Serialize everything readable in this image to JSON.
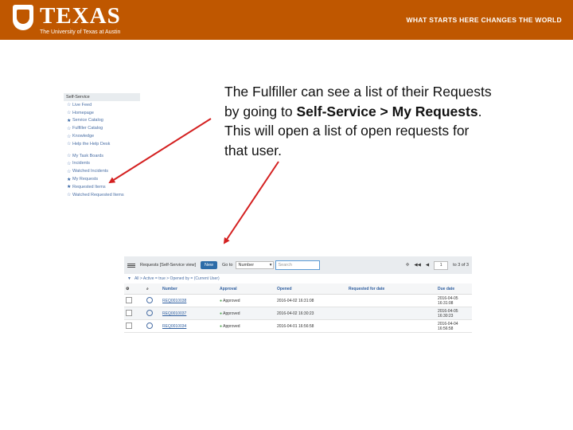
{
  "header": {
    "logo_word": "TEXAS",
    "logo_sub": "The University of Texas at Austin",
    "tagline": "WHAT STARTS HERE CHANGES THE WORLD",
    "brand_color": "#bf5700"
  },
  "nav": {
    "title": "Self-Service",
    "items_top": [
      {
        "label": "Live Feed",
        "icon": "star-outline-icon"
      },
      {
        "label": "Homepage",
        "icon": "star-outline-icon"
      },
      {
        "label": "Service Catalog",
        "icon": "star-filled-icon"
      },
      {
        "label": "Fulfiller Catalog",
        "icon": "star-outline-icon"
      },
      {
        "label": "Knowledge",
        "icon": "star-outline-icon"
      },
      {
        "label": "Help the Help Desk",
        "icon": "star-outline-icon"
      }
    ],
    "items_bottom": [
      {
        "label": "My Task Boards",
        "icon": "star-outline-icon"
      },
      {
        "label": "Incidents",
        "icon": "star-outline-icon"
      },
      {
        "label": "Watched Incidents",
        "icon": "star-outline-icon"
      },
      {
        "label": "My Requests",
        "icon": "star-filled-icon"
      },
      {
        "label": "Requested Items",
        "icon": "star-filled-icon"
      },
      {
        "label": "Watched Requested Items",
        "icon": "star-outline-icon"
      }
    ]
  },
  "description": {
    "part1": "The Fulfiller can see a list of their Requests by going to ",
    "bold1": "Self-Service > My Requests",
    "part2": ". This will open a list of open requests for that user."
  },
  "list": {
    "title": "Requests [Self-Service view]",
    "new_label": "New",
    "goto_label": "Go to",
    "goto_field": "Number",
    "search_placeholder": "Search",
    "page_value": "1",
    "page_total": "to 3 of 3",
    "breadcrumb": "All > Active = true > Opened by = (Current User)",
    "columns": [
      "Number",
      "Approval",
      "Opened",
      "Requested for date",
      "Due date"
    ],
    "rows": [
      {
        "number": "REQ0010038",
        "approval": "Approved",
        "opened": "2016-04-02 16:31:08",
        "requested_for": "",
        "due": "2016-04-05 16:31:08"
      },
      {
        "number": "REQ0010037",
        "approval": "Approved",
        "opened": "2016-04-02 16:30:23",
        "requested_for": "",
        "due": "2016-04-05 16:30:23"
      },
      {
        "number": "REQ0010034",
        "approval": "Approved",
        "opened": "2016-04-01 16:56:58",
        "requested_for": "",
        "due": "2016-04-04 16:56:58"
      }
    ]
  }
}
